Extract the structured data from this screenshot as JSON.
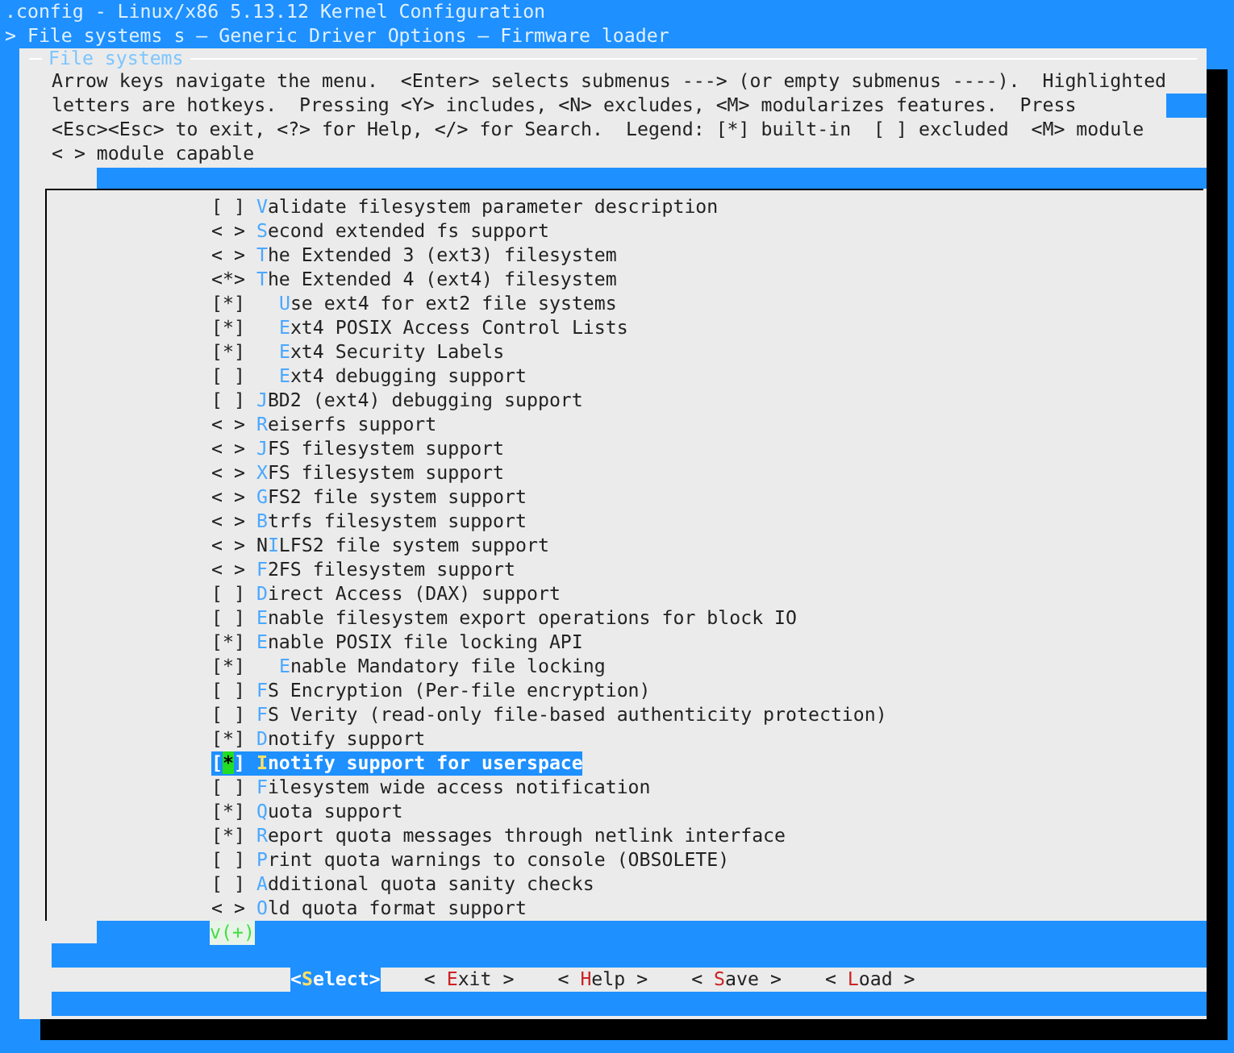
{
  "window": {
    "title": ".config - Linux/x86 5.13.12 Kernel Configuration"
  },
  "breadcrumb": "> File systems s — Generic Driver Options — Firmware loader",
  "dialog": {
    "title": "File systems",
    "help": "Arrow keys navigate the menu.  <Enter> selects submenus ---> (or empty submenus ----).  Highlighted\nletters are hotkeys.  Pressing <Y> includes, <N> excludes, <M> modularizes features.  Press\n<Esc><Esc> to exit, <?> for Help, </> for Search.  Legend: [*] built-in  [ ] excluded  <M> module\n< > module capable"
  },
  "items": [
    {
      "box": "[ ]",
      "hotkey": "V",
      "label": "alidate filesystem parameter description",
      "selected": false
    },
    {
      "box": "< >",
      "hotkey": "S",
      "label": "econd extended fs support",
      "selected": false
    },
    {
      "box": "< >",
      "hotkey": "T",
      "label": "he Extended 3 (ext3) filesystem",
      "selected": false
    },
    {
      "box": "<*>",
      "hotkey": "T",
      "label": "he Extended 4 (ext4) filesystem",
      "selected": false,
      "children": [
        {
          "box": "[*]",
          "hotkey": "U",
          "label": "se ext4 for ext2 file systems",
          "selected": false
        },
        {
          "box": "[*]",
          "hotkey": "E",
          "label": "xt4 POSIX Access Control Lists",
          "selected": false
        },
        {
          "box": "[*]",
          "hotkey": "E",
          "label": "xt4 Security Labels",
          "selected": false
        },
        {
          "box": "[ ]",
          "hotkey": "E",
          "label": "xt4 debugging support",
          "selected": false
        }
      ]
    },
    {
      "box": "[ ]",
      "hotkey": "J",
      "label": "BD2 (ext4) debugging support",
      "selected": false
    },
    {
      "box": "< >",
      "hotkey": "R",
      "label": "eiserfs support",
      "selected": false
    },
    {
      "box": "< >",
      "hotkey": "J",
      "label": "FS filesystem support",
      "selected": false
    },
    {
      "box": "< >",
      "hotkey": "X",
      "label": "FS filesystem support",
      "selected": false
    },
    {
      "box": "< >",
      "hotkey": "G",
      "label": "FS2 file system support",
      "selected": false
    },
    {
      "box": "< >",
      "hotkey": "B",
      "label": "trfs filesystem support",
      "selected": false
    },
    {
      "box": "< >",
      "lead": "N",
      "hotkey": "I",
      "label": "LFS2 file system support",
      "selected": false
    },
    {
      "box": "< >",
      "hotkey": "F",
      "label": "2FS filesystem support",
      "selected": false
    },
    {
      "box": "[ ]",
      "hotkey": "D",
      "label": "irect Access (DAX) support",
      "selected": false
    },
    {
      "box": "[ ]",
      "hotkey": "E",
      "label": "nable filesystem export operations for block IO",
      "selected": false
    },
    {
      "box": "[*]",
      "hotkey": "E",
      "label": "nable POSIX file locking API",
      "selected": false,
      "children": [
        {
          "box": "[*]",
          "hotkey": "E",
          "label": "nable Mandatory file locking",
          "selected": false
        }
      ]
    },
    {
      "box": "[ ]",
      "hotkey": "F",
      "label": "S Encryption (Per-file encryption)",
      "selected": false
    },
    {
      "box": "[ ]",
      "hotkey": "F",
      "label": "S Verity (read-only file-based authenticity protection)",
      "selected": false
    },
    {
      "box": "[*]",
      "hotkey": "D",
      "label": "notify support",
      "selected": false
    },
    {
      "box": "[*]",
      "hotkey": "I",
      "label": "notify support for userspace",
      "selected": true
    },
    {
      "box": "[ ]",
      "hotkey": "F",
      "label": "ilesystem wide access notification",
      "selected": false
    },
    {
      "box": "[*]",
      "hotkey": "Q",
      "label": "uota support",
      "selected": false
    },
    {
      "box": "[*]",
      "hotkey": "R",
      "label": "eport quota messages through netlink interface",
      "selected": false
    },
    {
      "box": "[ ]",
      "hotkey": "P",
      "label": "rint quota warnings to console (OBSOLETE)",
      "selected": false
    },
    {
      "box": "[ ]",
      "hotkey": "A",
      "label": "dditional quota sanity checks",
      "selected": false
    },
    {
      "box": "< >",
      "hotkey": "O",
      "label": "ld quota format support",
      "selected": false
    }
  ],
  "more_indicator": "v(+)",
  "buttons": [
    {
      "lead": "<",
      "hotkey": "S",
      "label": "elect>",
      "selected": true
    },
    {
      "lead": "< ",
      "hotkey": "E",
      "label": "xit >",
      "selected": false
    },
    {
      "lead": "< ",
      "hotkey": "H",
      "label": "elp >",
      "selected": false
    },
    {
      "lead": "< ",
      "hotkey": "S",
      "label": "ave >",
      "selected": false
    },
    {
      "lead": "< ",
      "hotkey": "L",
      "label": "oad >",
      "selected": false
    }
  ]
}
